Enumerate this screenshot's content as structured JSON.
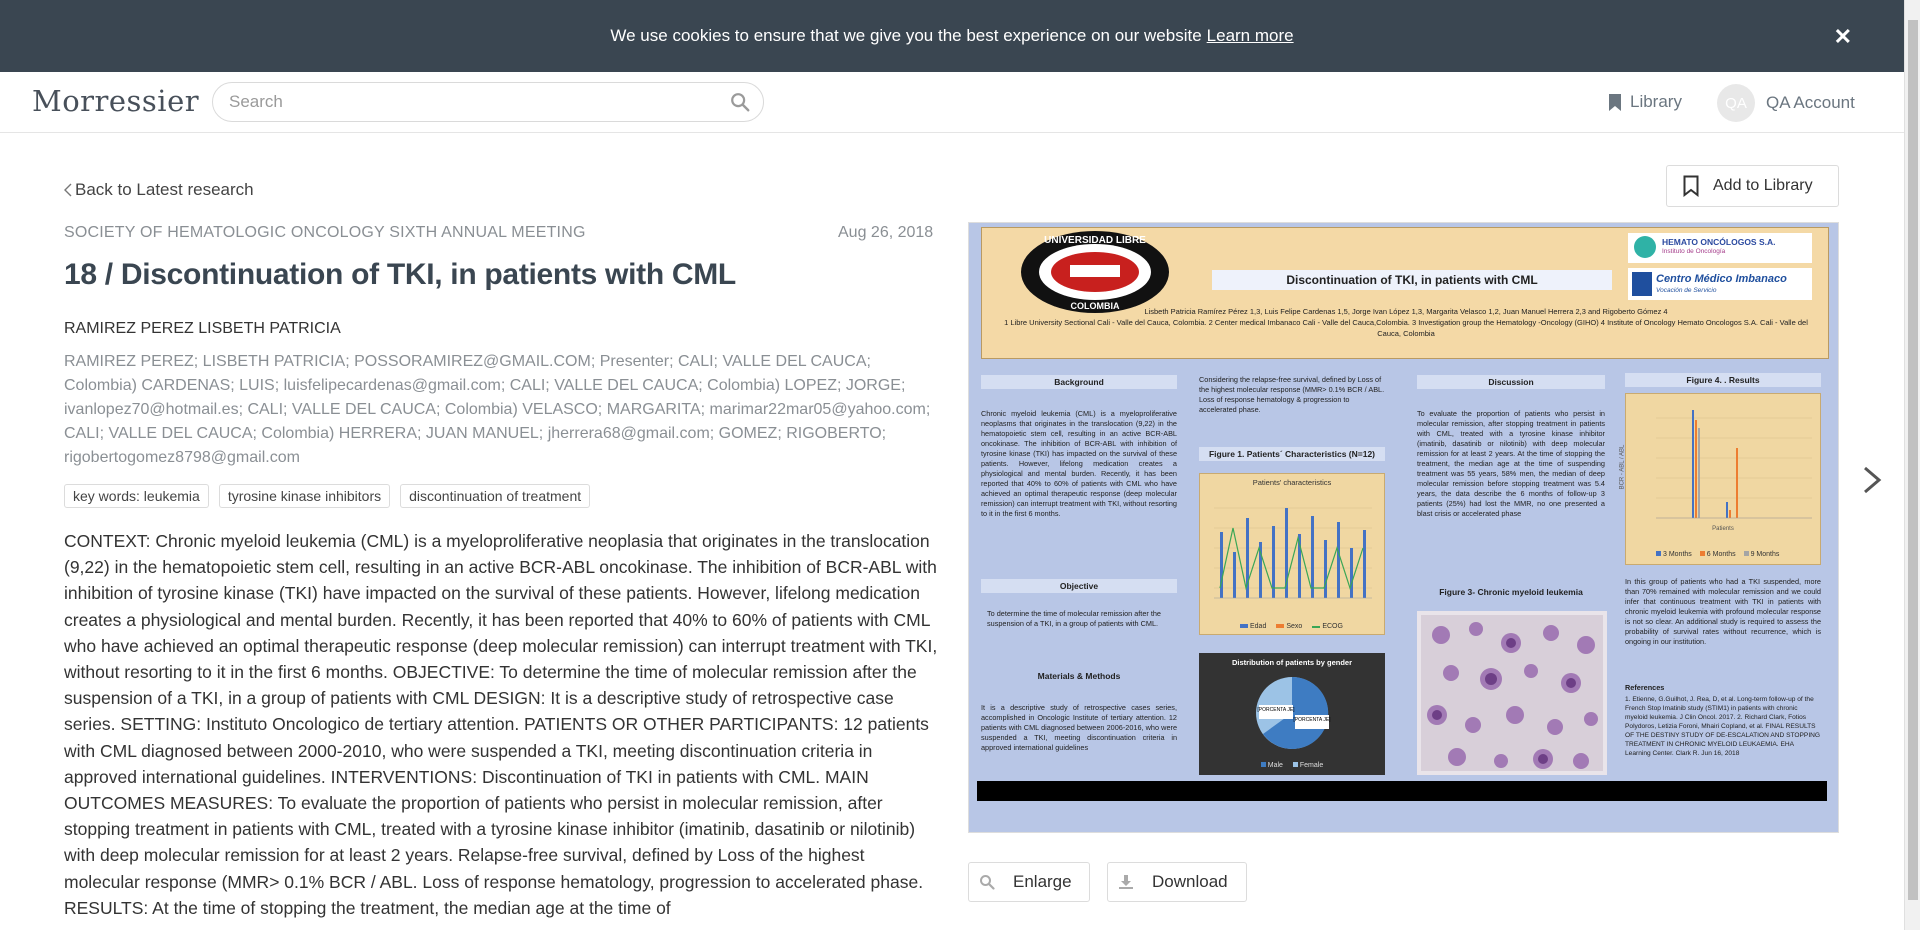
{
  "cookie_bar": {
    "message": "We use cookies to ensure that we give you the best experience on our website",
    "learn_more": "Learn more",
    "close_glyph": "✕"
  },
  "nav": {
    "logo": "Morressier",
    "search_placeholder": "Search",
    "library": "Library",
    "avatar_initials": "QA",
    "account": "QA Account"
  },
  "page": {
    "back_link": "Back to Latest research",
    "event": "SOCIETY OF HEMATOLOGIC ONCOLOGY SIXTH ANNUAL MEETING",
    "date": "Aug 26, 2018",
    "title": "18 / Discontinuation of TKI, in patients with CML",
    "presenter": "RAMIREZ PEREZ LISBETH PATRICIA",
    "authors": "RAMIREZ PEREZ; LISBETH PATRICIA; POSSORAMIREZ@GMAIL.COM; Presenter; CALI; VALLE DEL CAUCA; Colombia) CARDENAS; LUIS; luisfelipecardenas@gmail.com; CALI; VALLE DEL CAUCA; Colombia) LOPEZ; JORGE; ivanlopez70@hotmail.es; CALI; VALLE DEL CAUCA; Colombia) VELASCO; MARGARITA; marimar22mar05@yahoo.com; CALI; VALLE DEL CAUCA; Colombia) HERRERA; JUAN MANUEL; jherrera68@gmail.com; GOMEZ; RIGOBERTO; rigobertogomez8798@gmail.com",
    "keywords": [
      "key words: leukemia",
      "tyrosine kinase inhibitors",
      "discontinuation of treatment"
    ],
    "abstract": "CONTEXT: Chronic myeloid leukemia (CML) is a myeloproliferative neoplasia that originates in the translocation (9,22) in the hematopoietic stem cell, resulting in an active BCR-ABL oncokinase. The inhibition of BCR-ABL with inhibition of tyrosine kinase (TKI) have impacted on the survival of these patients. However, lifelong medication creates a physiological and mental burden. Recently, it has been reported that 40% to 60% of patients with CML who have achieved an optimal therapeutic response (deep molecular remission) can interrupt treatment with TKI, without resorting to it in the first 6 months. OBJECTIVE: To determine the time of molecular remission after the suspension of a TKI, in a group of patients with CML DESIGN: It is a descriptive study of retrospective case series. SETTING: Instituto Oncologico de tertiary attention. PATIENTS OR OTHER PARTICIPANTS: 12 patients with CML diagnosed between 2000-2010, who were suspended a TKI, meeting discontinuation criteria in approved international guidelines. INTERVENTIONS: Discontinuation of TKI in patients with CML. MAIN OUTCOMES MEASURES: To evaluate the proportion of patients who persist in molecular remission, after stopping treatment in patients with CML, treated with a tyrosine kinase inhibitor (imatinib, dasatinib or nilotinib) with deep molecular remission for at least 2 years. Relapse-free survival, defined by Loss of the highest molecular response (MMR> 0.1% BCR / ABL. Loss of response hematology, progression to accelerated phase. RESULTS: At the time of stopping the treatment, the median age at the time of"
  },
  "actions": {
    "add_to_library": "Add to Library",
    "enlarge": "Enlarge",
    "download": "Download"
  },
  "poster": {
    "university_top": "UNIVERSIDAD LIBRE",
    "university_bottom": "COLOMBIA",
    "logo_right_1": "HEMATO ONCÓLOGOS S.A.",
    "logo_right_1_sub": "Instituto de Oncología",
    "logo_right_2": "Centro Médico Imbanaco",
    "logo_right_2_sub": "Vocación de Servicio",
    "title": "Discontinuation of TKI, in patients with CML",
    "authors": "Lisbeth Patricia Ramírez Pérez 1,3, Luis Felipe Cardenas 1,5, Jorge Ivan López 1,3, Margarita Velasco 1,2, Juan Manuel Herrera 2,3 and Rigoberto Gómez 4",
    "affiliations": "1 Libre University Sectional Cali - Valle del Cauca, Colombia. 2 Center medical Imbanaco Cali - Valle del Cauca,Colombia. 3 Investigation group the Hematology -Oncology (GIHO) 4 Institute of Oncology Hemato Oncologos S.A. Cali - Valle del Cauca, Colombia",
    "background_head": "Background",
    "background_text": "Chronic myeloid leukemia (CML) is a myeloproliferative neoplasms that originates in the translocation (9,22) in the hematopoietic stem cell, resulting in an active BCR-ABL oncokinase. The inhibition of BCR-ABL with inhibition of tyrosine kinase (TKI) has impacted on the survival of these patients. However, lifelong medication creates a physiological and mental burden. Recently, it has been reported that 40% to 60% of patients with CML who have achieved an optimal therapeutic response (deep molecular remission) can interrupt treatment with TKI, without resorting to it in the first 6 months.",
    "objective_head": "Objective",
    "objective_text": "To determine the time of molecular remission after the suspension of a TKI, in a group of patients with CML.",
    "methods_head": "Materials & Methods",
    "methods_text": "It is a descriptive study of retrospective cases series, accomplished in Oncologic Institute of tertiary attention. 12 patients with CML diagnosed between 2006-2016, who were suspended a TKI, meeting discontinuation criteria in approved international guidelines",
    "col2_text": "Considering the relapse-free survival, defined by Loss of the highest molecular response (MMR> 0.1% BCR / ABL. Loss of response hematology & progression to accelerated phase.",
    "fig1_head": "Figure 1. Patients´ Characteristics (N=12)",
    "fig1_title": "Patients' characteristics",
    "fig1_legend": [
      "Edad",
      "Sexo",
      "ECOG"
    ],
    "pie_title": "Distribution of patients by gender",
    "pie_labels": [
      "[PORCENTA JE]",
      "[PORCENTA JE]"
    ],
    "pie_legend": [
      "Male",
      "Female"
    ],
    "discussion_head": "Discussion",
    "discussion_text": "To evaluate the proportion of patients who persist in molecular remission, after stopping treatment in patients with CML, treated with a tyrosine kinase inhibitor (imatinib, dasatinib or nilotinib) with deep molecular remission for at least 2 years. At the time of stopping the treatment, the median age at the time of suspending treatment was 55 years, 58% men, the median of deep molecular remission before stopping treatment was 5.4 years, the data describe the 6 months of follow-up 3 patients (25%) had lost the MMR, no one presented a blast crisis or accelerated phase",
    "fig3_head": "Figure 3- Chronic myeloid leukemia",
    "fig4_head": "Figure 4. . Results",
    "fig4_ylabel": "BCR - ABL / ABL",
    "fig4_xlabel": "Patients",
    "fig4_legend": [
      "3 Months",
      "6 Months",
      "9 Months"
    ],
    "results_text": "In this group of patients who had a TKI suspended, more than 70% remained with molecular remission and we could infer that continuous treatment with TKI in patients with chronic myeloid leukemia with profound molecular response is not so clear. An additional study is required to assess the probability of survival rates without recurrence, which is ongoing in our institution.",
    "references_head": "References",
    "references_text": "1. Etienne, G.Guilhot, J. Rea, D, et al. Long-term follow-up of the French Stop Imatinib study (STIM1) in patients with chronic myeloid leukemia. J Clin Oncol. 2017. 2. Richard Clark, Fotios Polydoros, Letizia Foroni, Mhairi Copland, et al. FINAL RESULTS OF THE DESTINY STUDY OF DE-ESCALATION AND STOPPING TREATMENT IN CHRONIC MYELOID LEUKAEMIA. EHA Learning Center. Clark R. Jun 16, 2018",
    "colors": {
      "background": "#b8c6e6",
      "header": "#f4d9a6",
      "bar_blue": "#4472c4",
      "line_green": "#3aa655",
      "bar_orange": "#ed7d31"
    }
  }
}
